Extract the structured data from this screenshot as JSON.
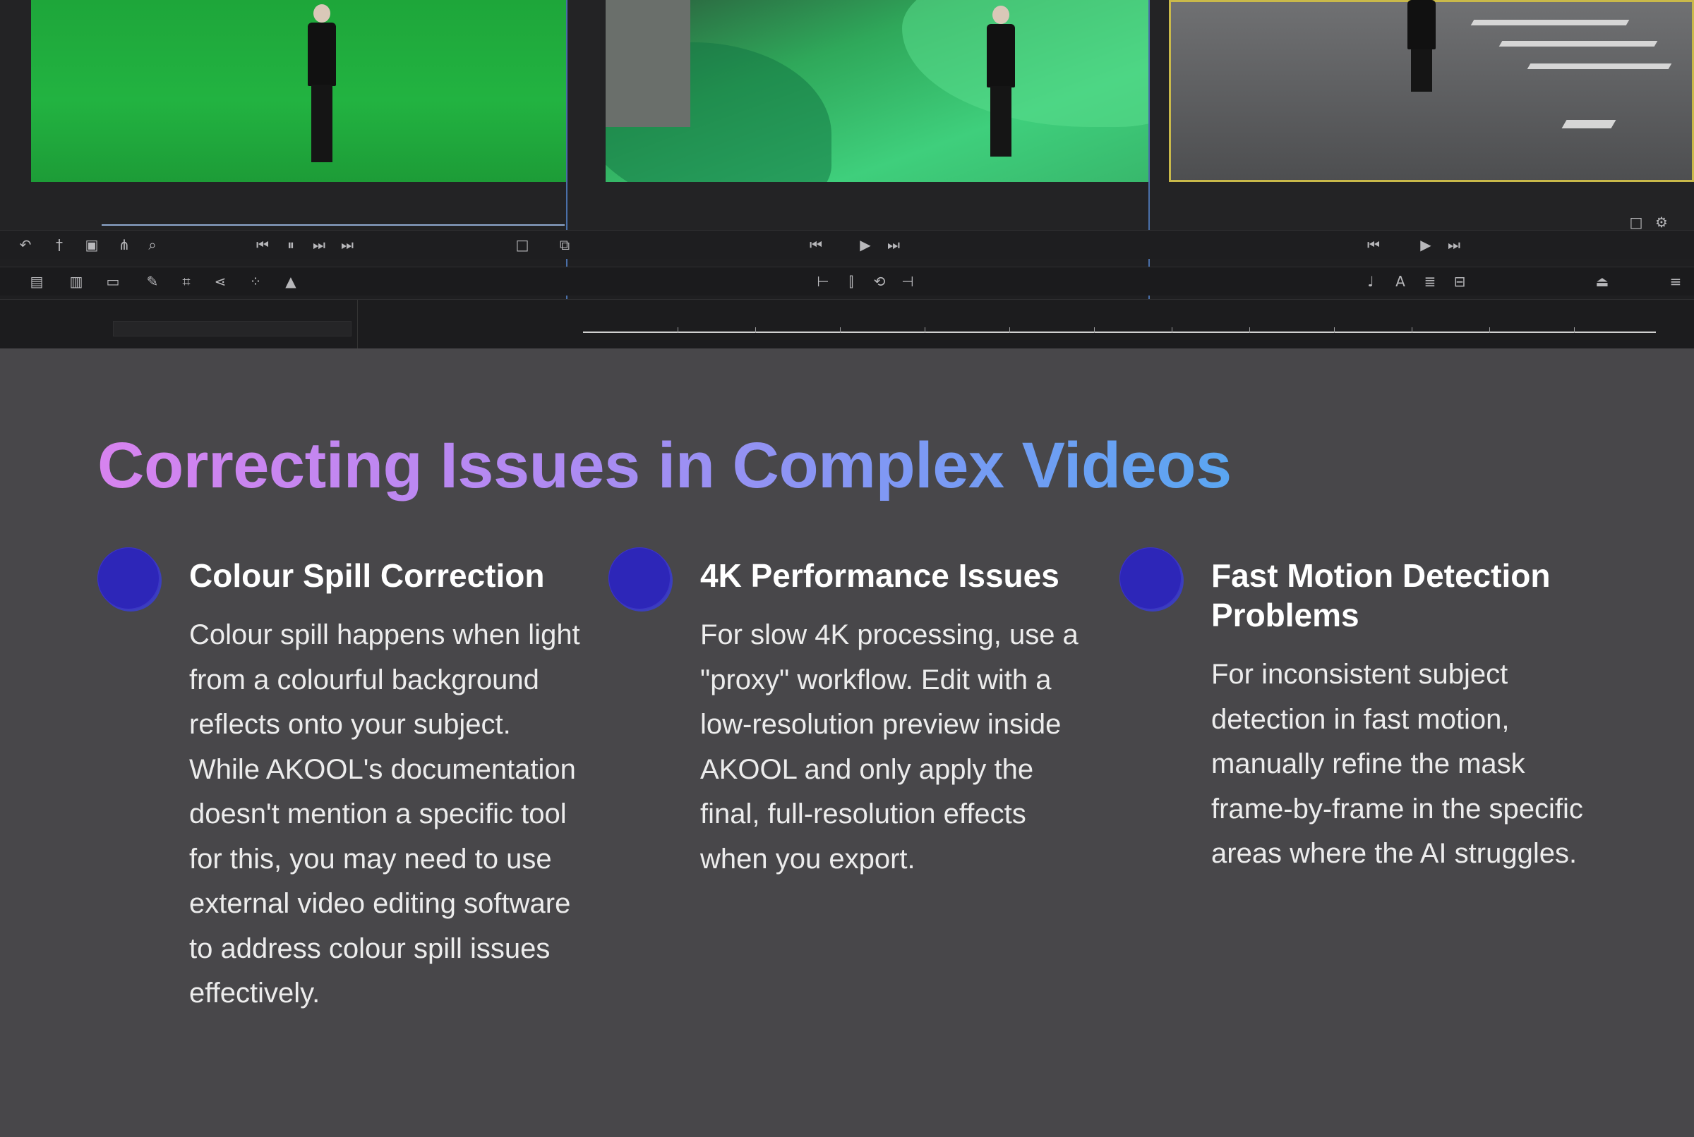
{
  "heading": {
    "title": "Correcting Issues in Complex Videos",
    "gradient_colors": [
      "#d783ef",
      "#b08af2",
      "#7f98f4",
      "#5aa6f2"
    ]
  },
  "cards": [
    {
      "title": "Colour Spill Correction",
      "body": "Colour spill happens when light from a colourful background reflects onto your subject. While AKOOL's documentation doesn't mention a specific tool for this, you may need to use external video editing software to address colour spill issues effectively.",
      "bullet_color": "#2d26b8"
    },
    {
      "title": "4K Performance Issues",
      "body": "For slow 4K processing, use a \"proxy\" workflow. Edit with a low-resolution preview inside AKOOL and only apply the final, full-resolution effects when you export.",
      "bullet_color": "#2d26b8"
    },
    {
      "title": "Fast Motion Detection Problems",
      "body": "For inconsistent subject detection in fast motion, manually refine the mask frame-by-frame in the specific areas where the AI struggles.",
      "bullet_color": "#2d26b8"
    }
  ],
  "editor_screenshot": {
    "panels": [
      "green-screen-studio",
      "green-screen-outdoor",
      "street-footage"
    ],
    "icons": [
      "back-icon",
      "marker-icon",
      "camera-icon",
      "split-icon",
      "zoom-icon",
      "step-back-icon",
      "pause-icon",
      "step-forward-icon",
      "end-icon",
      "play-icon",
      "folder-icon",
      "pen-icon",
      "share-icon",
      "grid-icon",
      "triangle-icon"
    ],
    "background_color": "#1f1f21"
  },
  "colors": {
    "page_background": "#48474a",
    "text": "#ececec",
    "heading_text": "#ffffff"
  }
}
